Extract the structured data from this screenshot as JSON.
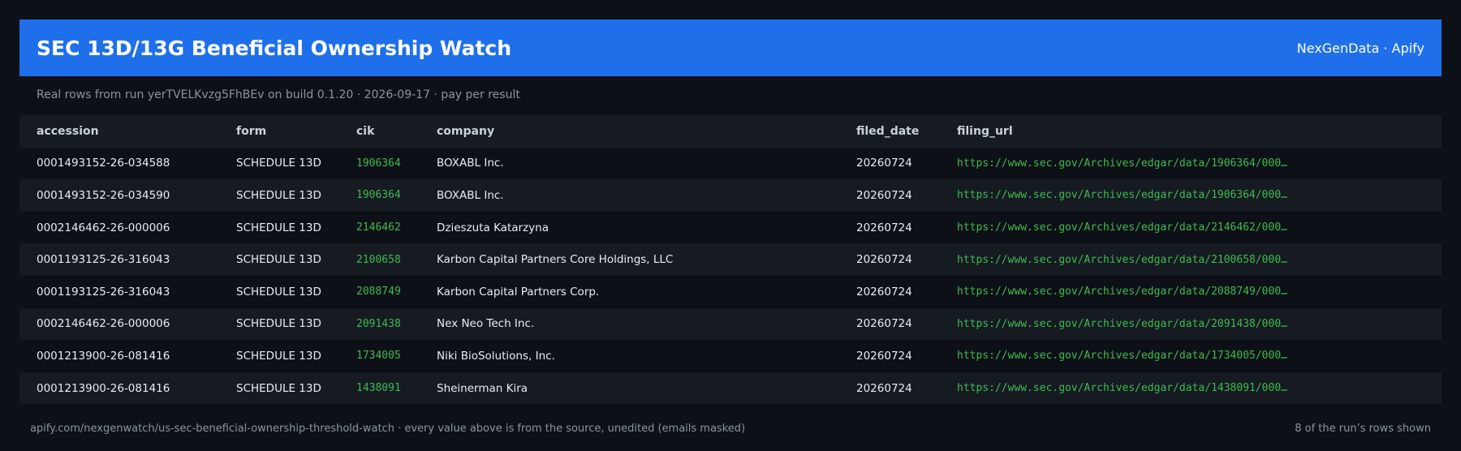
{
  "header": {
    "title": "SEC 13D/13G Beneficial Ownership Watch",
    "brand": "NexGenData · Apify"
  },
  "subtitle": "Real rows from run yerTVELKvzg5FhBEv on build 0.1.20 · 2026-09-17 · pay per result",
  "table": {
    "columns": [
      "accession",
      "form",
      "cik",
      "company",
      "filed_date",
      "filing_url"
    ],
    "rows": [
      {
        "accession": "0001493152-26-034588",
        "form": "SCHEDULE 13D",
        "cik": "1906364",
        "company": "BOXABL Inc.",
        "filed_date": "20260724",
        "filing_url": "https://www.sec.gov/Archives/edgar/data/1906364/000…"
      },
      {
        "accession": "0001493152-26-034590",
        "form": "SCHEDULE 13D",
        "cik": "1906364",
        "company": "BOXABL Inc.",
        "filed_date": "20260724",
        "filing_url": "https://www.sec.gov/Archives/edgar/data/1906364/000…"
      },
      {
        "accession": "0002146462-26-000006",
        "form": "SCHEDULE 13D",
        "cik": "2146462",
        "company": "Dzieszuta Katarzyna",
        "filed_date": "20260724",
        "filing_url": "https://www.sec.gov/Archives/edgar/data/2146462/000…"
      },
      {
        "accession": "0001193125-26-316043",
        "form": "SCHEDULE 13D",
        "cik": "2100658",
        "company": "Karbon Capital Partners Core Holdings, LLC",
        "filed_date": "20260724",
        "filing_url": "https://www.sec.gov/Archives/edgar/data/2100658/000…"
      },
      {
        "accession": "0001193125-26-316043",
        "form": "SCHEDULE 13D",
        "cik": "2088749",
        "company": "Karbon Capital Partners Corp.",
        "filed_date": "20260724",
        "filing_url": "https://www.sec.gov/Archives/edgar/data/2088749/000…"
      },
      {
        "accession": "0002146462-26-000006",
        "form": "SCHEDULE 13D",
        "cik": "2091438",
        "company": "Nex Neo Tech Inc.",
        "filed_date": "20260724",
        "filing_url": "https://www.sec.gov/Archives/edgar/data/2091438/000…"
      },
      {
        "accession": "0001213900-26-081416",
        "form": "SCHEDULE 13D",
        "cik": "1734005",
        "company": "Niki BioSolutions, Inc.",
        "filed_date": "20260724",
        "filing_url": "https://www.sec.gov/Archives/edgar/data/1734005/000…"
      },
      {
        "accession": "0001213900-26-081416",
        "form": "SCHEDULE 13D",
        "cik": "1438091",
        "company": "Sheinerman Kira",
        "filed_date": "20260724",
        "filing_url": "https://www.sec.gov/Archives/edgar/data/1438091/000…"
      }
    ]
  },
  "footer": {
    "left": "apify.com/nexgenwatch/us-sec-beneficial-ownership-threshold-watch  ·  every value above is from the source, unedited (emails masked)",
    "right": "8 of the run’s rows shown"
  },
  "colors": {
    "background": "#0d1117",
    "header": "#1f6feb",
    "accent_green": "#3fb950",
    "muted": "#8b949e"
  }
}
